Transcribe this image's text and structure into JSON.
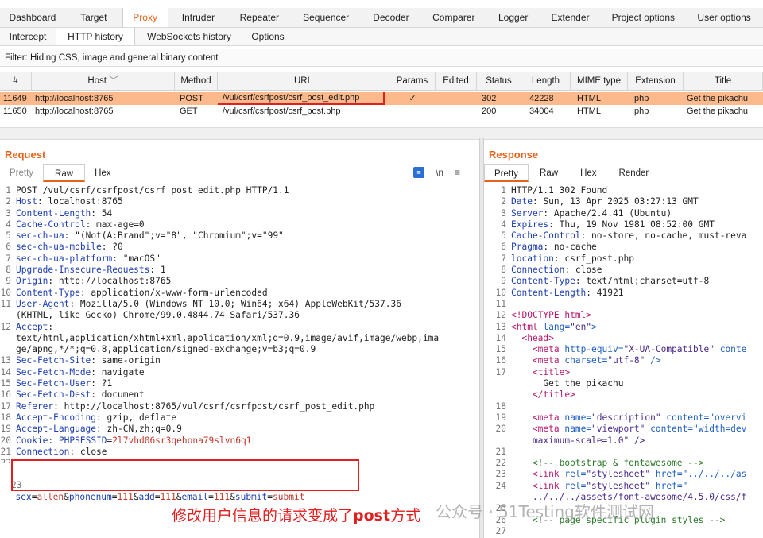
{
  "top_tabs": [
    "Dashboard",
    "Target",
    "Proxy",
    "Intruder",
    "Repeater",
    "Sequencer",
    "Decoder",
    "Comparer",
    "Logger",
    "Extender",
    "Project options",
    "User options"
  ],
  "sub_tabs": [
    "Intercept",
    "HTTP history",
    "WebSockets history",
    "Options"
  ],
  "filter_text": "Filter: Hiding CSS, image and general binary content",
  "table": {
    "headers": [
      "#",
      "Host",
      "Method",
      "URL",
      "Params",
      "Edited",
      "Status",
      "Length",
      "MIME type",
      "Extension",
      "Title"
    ],
    "sort_glyph": "﹀",
    "rows": [
      {
        "id": "11649",
        "host": "http://localhost:8765",
        "method": "POST",
        "url": "/vul/csrf/csrfpost/csrf_post_edit.php",
        "params": "✓",
        "edited": "",
        "status": "302",
        "length": "42228",
        "mime": "HTML",
        "ext": "php",
        "title": "Get the pikachu"
      },
      {
        "id": "11650",
        "host": "http://localhost:8765",
        "method": "GET",
        "url": "/vul/csrf/csrfpost/csrf_post.php",
        "params": "",
        "edited": "",
        "status": "200",
        "length": "34004",
        "mime": "HTML",
        "ext": "php",
        "title": "Get the pikachu"
      }
    ]
  },
  "request": {
    "title": "Request",
    "tabs": [
      "Pretty",
      "Raw",
      "Hex"
    ],
    "toolbar": {
      "format_icon": "≡",
      "newline": "\\n",
      "menu": "≡"
    },
    "lines": [
      {
        "n": "1",
        "k": "POST /vul/csrf/csrfpost/csrf_post_edit.php HTTP/1.1",
        "v": ""
      },
      {
        "n": "2",
        "k": "Host",
        "v": " localhost:8765"
      },
      {
        "n": "3",
        "k": "Content-Length",
        "v": " 54"
      },
      {
        "n": "4",
        "k": "Cache-Control",
        "v": " max-age=0"
      },
      {
        "n": "5",
        "k": "sec-ch-ua",
        "v": " \"(Not(A:Brand\";v=\"8\", \"Chromium\";v=\"99\""
      },
      {
        "n": "6",
        "k": "sec-ch-ua-mobile",
        "v": " ?0"
      },
      {
        "n": "7",
        "k": "sec-ch-ua-platform",
        "v": " \"macOS\""
      },
      {
        "n": "8",
        "k": "Upgrade-Insecure-Requests",
        "v": " 1"
      },
      {
        "n": "9",
        "k": "Origin",
        "v": " http://localhost:8765"
      },
      {
        "n": "10",
        "k": "Content-Type",
        "v": " application/x-www-form-urlencoded"
      },
      {
        "n": "11",
        "k": "User-Agent",
        "v": " Mozilla/5.0 (Windows NT 10.0; Win64; x64) AppleWebKit/537.36"
      },
      {
        "n": "",
        "k": "",
        "v": "(KHTML, like Gecko) Chrome/99.0.4844.74 Safari/537.36"
      },
      {
        "n": "12",
        "k": "Accept",
        "v": ""
      },
      {
        "n": "",
        "k": "",
        "v": "text/html,application/xhtml+xml,application/xml;q=0.9,image/avif,image/webp,ima"
      },
      {
        "n": "",
        "k": "",
        "v": "ge/apng,*/*;q=0.8,application/signed-exchange;v=b3;q=0.9"
      },
      {
        "n": "13",
        "k": "Sec-Fetch-Site",
        "v": " same-origin"
      },
      {
        "n": "14",
        "k": "Sec-Fetch-Mode",
        "v": " navigate"
      },
      {
        "n": "15",
        "k": "Sec-Fetch-User",
        "v": " ?1"
      },
      {
        "n": "16",
        "k": "Sec-Fetch-Dest",
        "v": " document"
      },
      {
        "n": "17",
        "k": "Referer",
        "v": " http://localhost:8765/vul/csrf/csrfpost/csrf_post_edit.php"
      },
      {
        "n": "18",
        "k": "Accept-Encoding",
        "v": " gzip, deflate"
      },
      {
        "n": "19",
        "k": "Accept-Language",
        "v": " zh-CN,zh;q=0.9"
      },
      {
        "n": "20",
        "k": "Cookie",
        "v": " PHPSESSID=2l7vhd06sr3qehona79slvn6q1"
      },
      {
        "n": "21",
        "k": "Connection",
        "v": " close"
      },
      {
        "n": "22",
        "k": "",
        "v": ""
      }
    ],
    "body_line_no": "23",
    "body_params": [
      {
        "k": "sex",
        "v": "allen"
      },
      {
        "k": "phonenum",
        "v": "111"
      },
      {
        "k": "add",
        "v": "111"
      },
      {
        "k": "email",
        "v": "111"
      },
      {
        "k": "submit",
        "v": "submit"
      }
    ]
  },
  "response": {
    "title": "Response",
    "tabs": [
      "Pretty",
      "Raw",
      "Hex",
      "Render"
    ],
    "lines": [
      {
        "n": "1",
        "t": "plain",
        "a": "HTTP/1.1 302 Found"
      },
      {
        "n": "2",
        "t": "hdr",
        "k": "Date",
        "v": " Sun, 13 Apr 2025 03:27:13 GMT"
      },
      {
        "n": "3",
        "t": "hdr",
        "k": "Server",
        "v": " Apache/2.4.41 (Ubuntu)"
      },
      {
        "n": "4",
        "t": "hdr",
        "k": "Expires",
        "v": " Thu, 19 Nov 1981 08:52:00 GMT"
      },
      {
        "n": "5",
        "t": "hdr",
        "k": "Cache-Control",
        "v": " no-store, no-cache, must-reva"
      },
      {
        "n": "6",
        "t": "hdr",
        "k": "Pragma",
        "v": " no-cache"
      },
      {
        "n": "7",
        "t": "hdr",
        "k": "location",
        "v": " csrf_post.php"
      },
      {
        "n": "8",
        "t": "hdr",
        "k": "Connection",
        "v": " close"
      },
      {
        "n": "9",
        "t": "hdr",
        "k": "Content-Type",
        "v": " text/html;charset=utf-8"
      },
      {
        "n": "10",
        "t": "hdr",
        "k": "Content-Length",
        "v": " 41921"
      },
      {
        "n": "11",
        "t": "plain",
        "a": ""
      },
      {
        "n": "12",
        "t": "tag",
        "a": "<!DOCTYPE html>"
      },
      {
        "n": "13",
        "t": "html",
        "a": "<html ",
        "b": "lang=",
        "c": "\"en\"",
        "d": ">"
      },
      {
        "n": "14",
        "t": "tag",
        "a": "  <head>"
      },
      {
        "n": "15",
        "t": "html",
        "a": "    <meta ",
        "b": "http-equiv=",
        "c": "\"X-UA-Compatible\"",
        "d": " conte"
      },
      {
        "n": "16",
        "t": "html",
        "a": "    <meta ",
        "b": "charset=",
        "c": "\"utf-8\"",
        "d": " />"
      },
      {
        "n": "17",
        "t": "tag",
        "a": "    <title>"
      },
      {
        "n": "",
        "t": "plain",
        "a": "      Get the pikachu"
      },
      {
        "n": "",
        "t": "tag",
        "a": "    </title>"
      },
      {
        "n": "18",
        "t": "plain",
        "a": ""
      },
      {
        "n": "19",
        "t": "html",
        "a": "    <meta ",
        "b": "name=",
        "c": "\"description\"",
        "d": " content=\"overvi"
      },
      {
        "n": "20",
        "t": "html",
        "a": "    <meta ",
        "b": "name=",
        "c": "\"viewport\"",
        "d": " content=\"width=dev"
      },
      {
        "n": "",
        "t": "str",
        "a": "    maximum-scale=1.0\" />"
      },
      {
        "n": "21",
        "t": "plain",
        "a": ""
      },
      {
        "n": "22",
        "t": "cmt",
        "a": "    <!-- bootstrap & fontawesome -->"
      },
      {
        "n": "23",
        "t": "html",
        "a": "    <link ",
        "b": "rel=",
        "c": "\"stylesheet\"",
        "d": " href=\"../../../as"
      },
      {
        "n": "24",
        "t": "html",
        "a": "    <link ",
        "b": "rel=",
        "c": "\"stylesheet\"",
        "d": " href=\""
      },
      {
        "n": "",
        "t": "str",
        "a": "    ../../../assets/font-awesome/4.5.0/css/f"
      },
      {
        "n": "25",
        "t": "plain",
        "a": ""
      },
      {
        "n": "26",
        "t": "cmt",
        "a": "    <!-- page specific plugin styles -->"
      },
      {
        "n": "27",
        "t": "plain",
        "a": ""
      }
    ]
  },
  "annotation": {
    "text_a": "修改用户信息的请求变成了",
    "text_b": "post",
    "text_c": "方式"
  },
  "watermark": "公众号 · 51Testing软件测试网",
  "colors": {
    "accent": "#e3651d",
    "selected_row": "#fbb98c",
    "highlight_box": "#e02020"
  }
}
